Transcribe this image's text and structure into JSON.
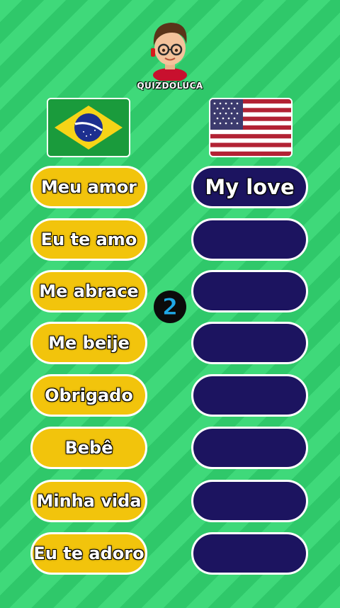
{
  "brand": {
    "name": "QUIZDOLUCA"
  },
  "flags": {
    "left": "Brazil flag",
    "right": "USA flag"
  },
  "timer": {
    "value": "2"
  },
  "colors": {
    "pt_pill": "#f2c40c",
    "en_pill": "#1c1460",
    "background": "#3fd97a",
    "timer_blue": "#1fa8e8"
  },
  "rows": [
    {
      "pt": "Meu amor",
      "en": "My love"
    },
    {
      "pt": "Eu te amo",
      "en": ""
    },
    {
      "pt": "Me abrace",
      "en": ""
    },
    {
      "pt": "Me beije",
      "en": ""
    },
    {
      "pt": "Obrigado",
      "en": ""
    },
    {
      "pt": "Bebê",
      "en": ""
    },
    {
      "pt": "Minha vida",
      "en": ""
    },
    {
      "pt": "Eu te adoro",
      "en": ""
    }
  ]
}
